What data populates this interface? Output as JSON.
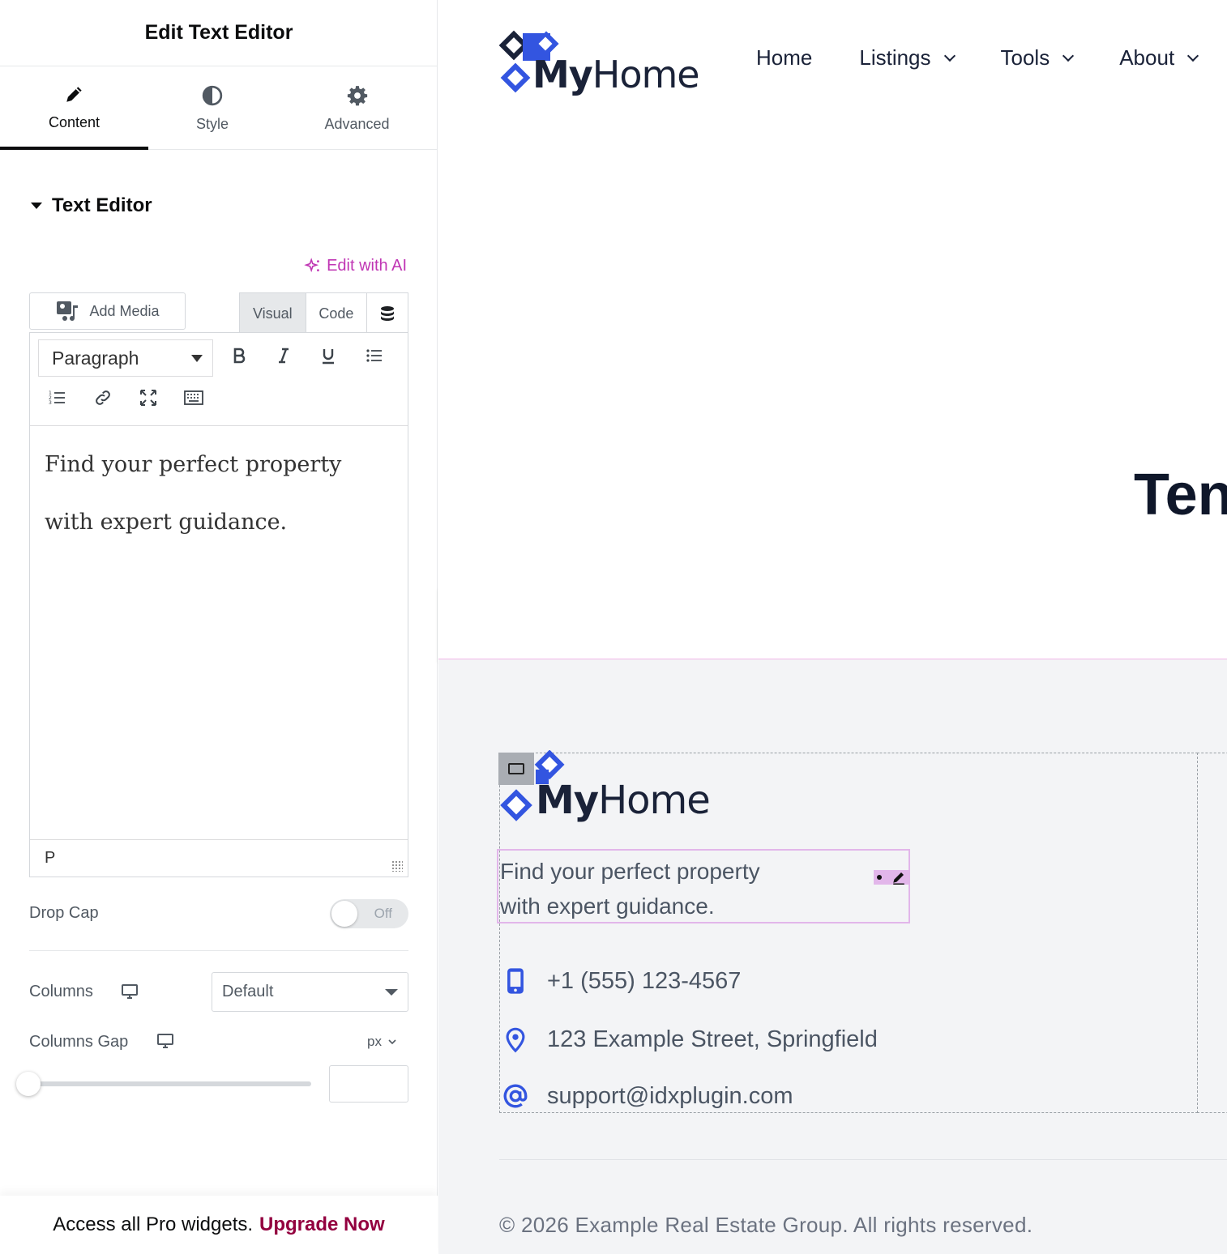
{
  "panel": {
    "title": "Edit Text Editor",
    "tabs": [
      {
        "label": "Content",
        "icon": "pencil-icon",
        "active": true
      },
      {
        "label": "Style",
        "icon": "half-circle-icon"
      },
      {
        "label": "Advanced",
        "icon": "gear-icon"
      }
    ],
    "section_title": "Text Editor",
    "edit_ai_label": "Edit with AI",
    "add_media_label": "Add Media",
    "mode_visual": "Visual",
    "mode_code": "Code",
    "paragraph_select": "Paragraph",
    "content_lines": [
      "Find your perfect property",
      "with expert guidance."
    ],
    "status_path": "P",
    "drop_cap_label": "Drop Cap",
    "drop_cap_state": "Off",
    "columns_label": "Columns",
    "columns_value": "Default",
    "columns_gap_label": "Columns Gap",
    "columns_gap_unit": "px",
    "columns_gap_value": 0,
    "promo_text": "Access all Pro widgets.",
    "promo_link": "Upgrade Now",
    "colors": {
      "accent_ai": "#c036b4",
      "upgrade": "#93003f"
    }
  },
  "preview": {
    "brand_name_bold": "My",
    "brand_name_rest": "Home",
    "nav": [
      {
        "label": "Home",
        "dropdown": false
      },
      {
        "label": "Listings",
        "dropdown": true
      },
      {
        "label": "Tools",
        "dropdown": true
      },
      {
        "label": "About",
        "dropdown": true
      }
    ],
    "hero_text_partial": "Ten",
    "footer": {
      "tagline_lines": [
        "Find your perfect property",
        "with expert guidance."
      ],
      "phone": "+1 (555) 123-4567",
      "address": "123 Example Street, Springfield",
      "email": "support@idxplugin.com",
      "copyright": "© 2026 Example Real Estate Group. All rights reserved."
    },
    "colors": {
      "brand_blue": "#3355e0",
      "brand_dark": "#1a2238",
      "selection": "#e2b6ea"
    }
  }
}
